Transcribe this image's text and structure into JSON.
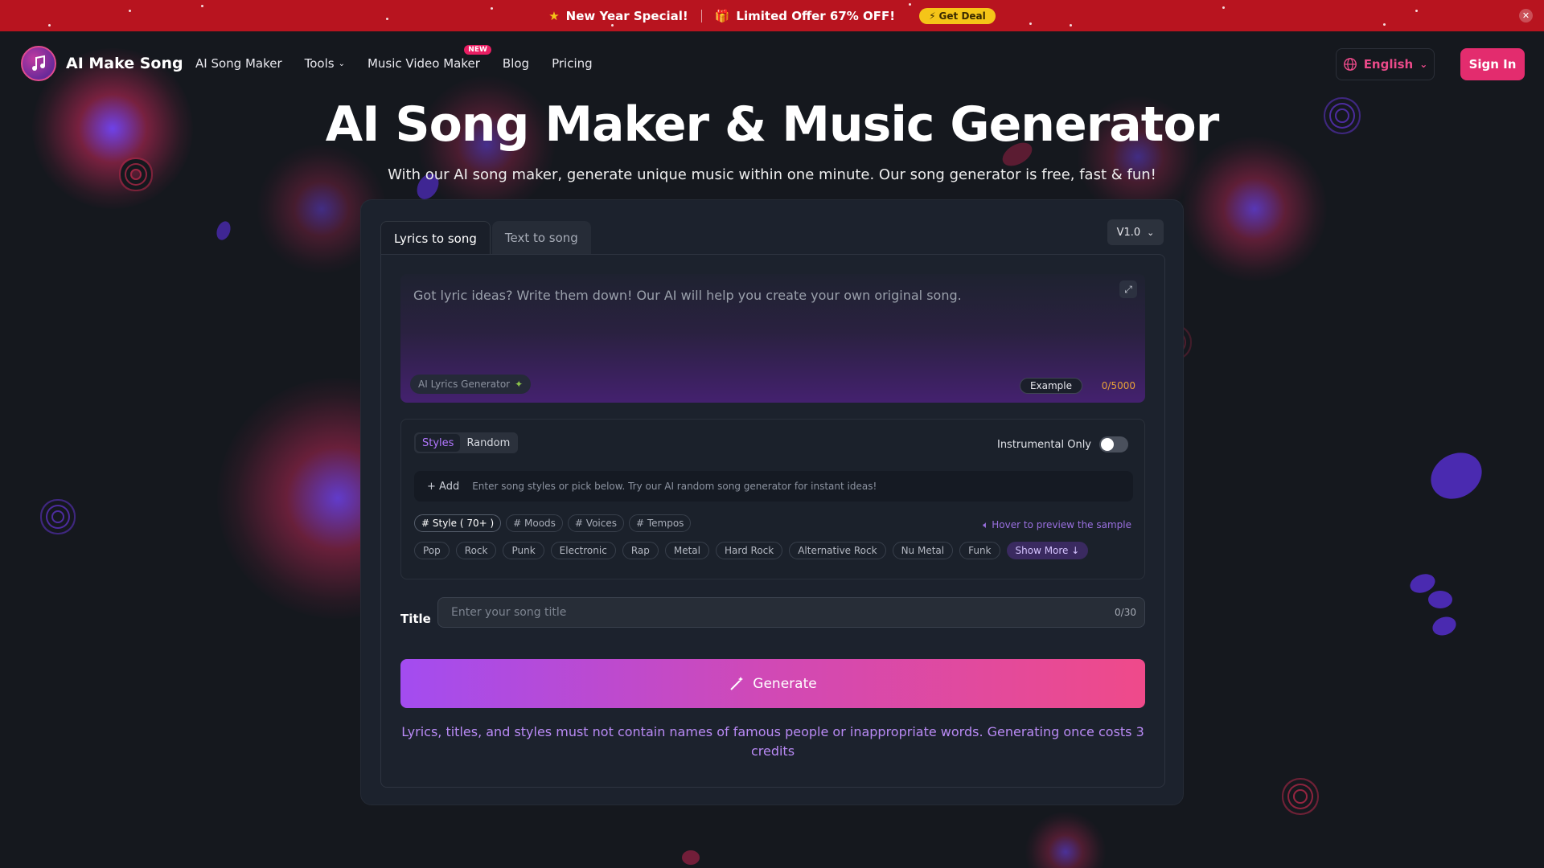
{
  "promo": {
    "special": "New Year Special!",
    "offer": "Limited Offer 67% OFF!",
    "deal_button": "Get Deal",
    "close_glyph": "✕"
  },
  "header": {
    "brand": "AI Make Song",
    "nav": [
      {
        "label": "AI Song Maker"
      },
      {
        "label": "Tools"
      },
      {
        "label": "Music Video Maker",
        "badge": "NEW"
      },
      {
        "label": "Blog"
      },
      {
        "label": "Pricing"
      }
    ],
    "language": "English",
    "sign_in": "Sign In"
  },
  "hero": {
    "title": "AI Song Maker & Music Generator",
    "subtitle": "With our AI song maker, generate unique music within one minute. Our song generator is free, fast & fun!"
  },
  "editor": {
    "tabs": [
      "Lyrics to song",
      "Text to song"
    ],
    "active_tab": "Lyrics to song",
    "version": "V1.0",
    "lyrics_placeholder": "Got lyric ideas? Write them down! Our AI will help you create your own original song.",
    "ai_lyrics_button": "AI Lyrics Generator",
    "example_button": "Example",
    "char_count": "0/5000",
    "style_modes": [
      "Styles",
      "Random"
    ],
    "instrumental_label": "Instrumental Only",
    "instrumental_on": false,
    "add_label": "+ Add",
    "style_placeholder": "Enter song styles or pick below. Try our AI random song generator for instant ideas!",
    "categories": [
      "# Style ( 70+ )",
      "# Moods",
      "# Voices",
      "# Tempos"
    ],
    "hover_note": "Hover to preview the sample",
    "chips": [
      "Pop",
      "Rock",
      "Punk",
      "Electronic",
      "Rap",
      "Metal",
      "Hard Rock",
      "Alternative Rock",
      "Nu Metal",
      "Funk"
    ],
    "show_more": "Show More ↓",
    "title_label": "Title",
    "title_placeholder": "Enter your song title",
    "title_count": "0/30",
    "generate_label": "Generate",
    "notice": "Lyrics, titles, and styles must not contain names of famous people or inappropriate words. Generating once costs 3 credits"
  },
  "colors": {
    "promo_bg": "#b8141f",
    "accent_pink": "#e32c6e",
    "accent_purple": "#a34cf0",
    "page_bg": "#15181e",
    "card_bg": "#1c222d"
  }
}
